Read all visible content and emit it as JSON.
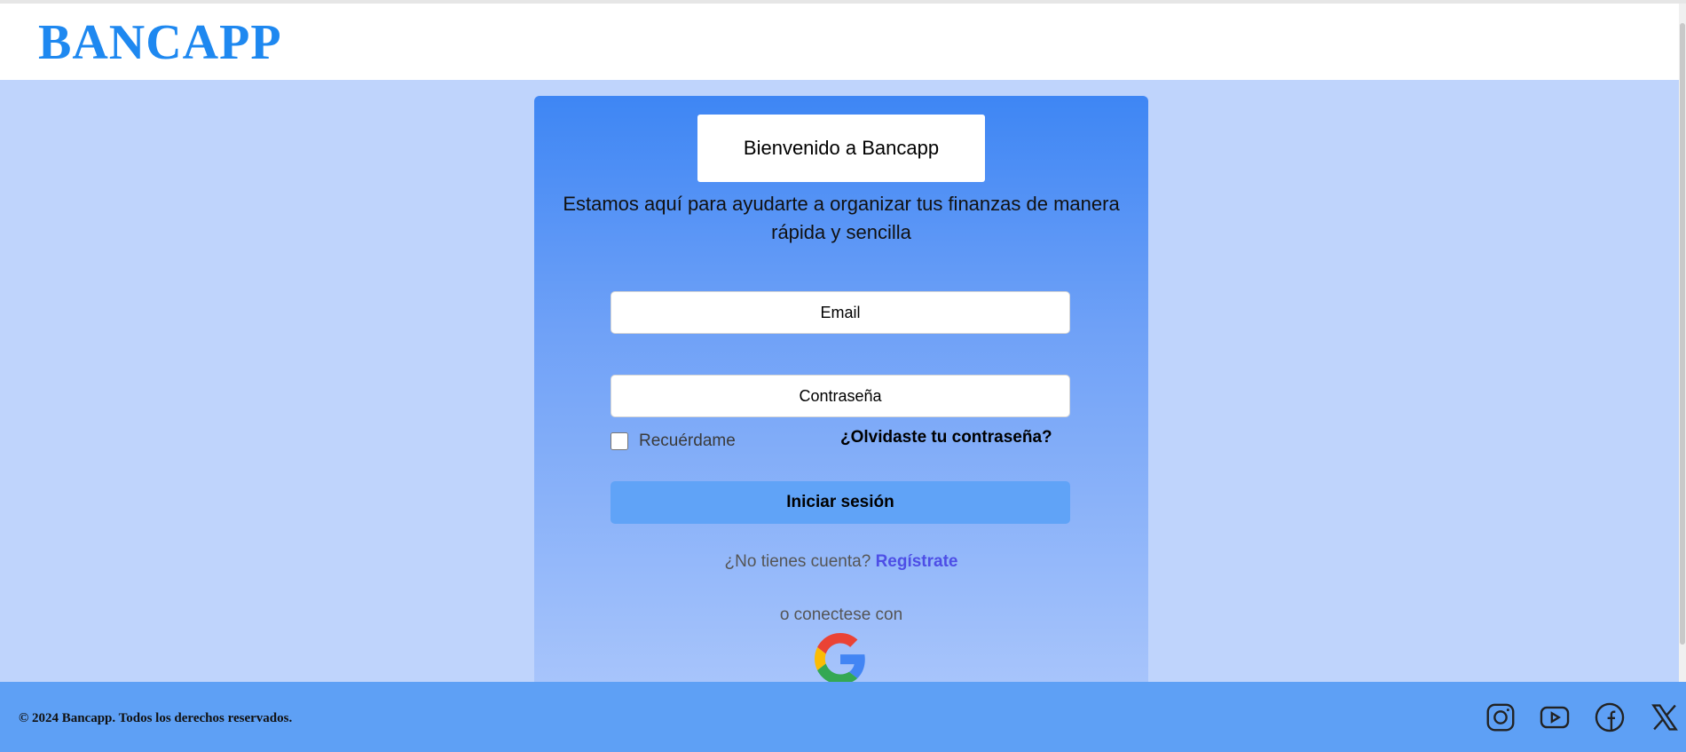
{
  "header": {
    "logo": "BANCAPP"
  },
  "card": {
    "welcome": "Bienvenido a Bancapp",
    "subtitle": "Estamos aquí para ayudarte a organizar tus finanzas de manera rápida y sencilla",
    "email_placeholder": "Email",
    "password_placeholder": "Contraseña",
    "remember_label": "Recuérdame",
    "remember_checked": false,
    "forgot_link": "¿Olvidaste tu contraseña?",
    "login_button": "Iniciar sesión",
    "no_account_text": "¿No tienes cuenta?",
    "register_link": "Regístrate",
    "connect_text": "o conectese con",
    "google_icon": "google-icon"
  },
  "footer": {
    "copyright": "© 2024 Bancapp. Todos los derechos reservados.",
    "social_icons": [
      "instagram-icon",
      "youtube-icon",
      "facebook-icon",
      "x-icon"
    ]
  },
  "colors": {
    "page_background": "#bfd4fc",
    "logo": "#1e88f0",
    "card_gradient_top": "#3e86f4",
    "card_gradient_bottom": "#a7c4fb",
    "login_button": "#60a3f7",
    "register_link": "#4d4ee6",
    "footer": "#5ea0f5"
  }
}
